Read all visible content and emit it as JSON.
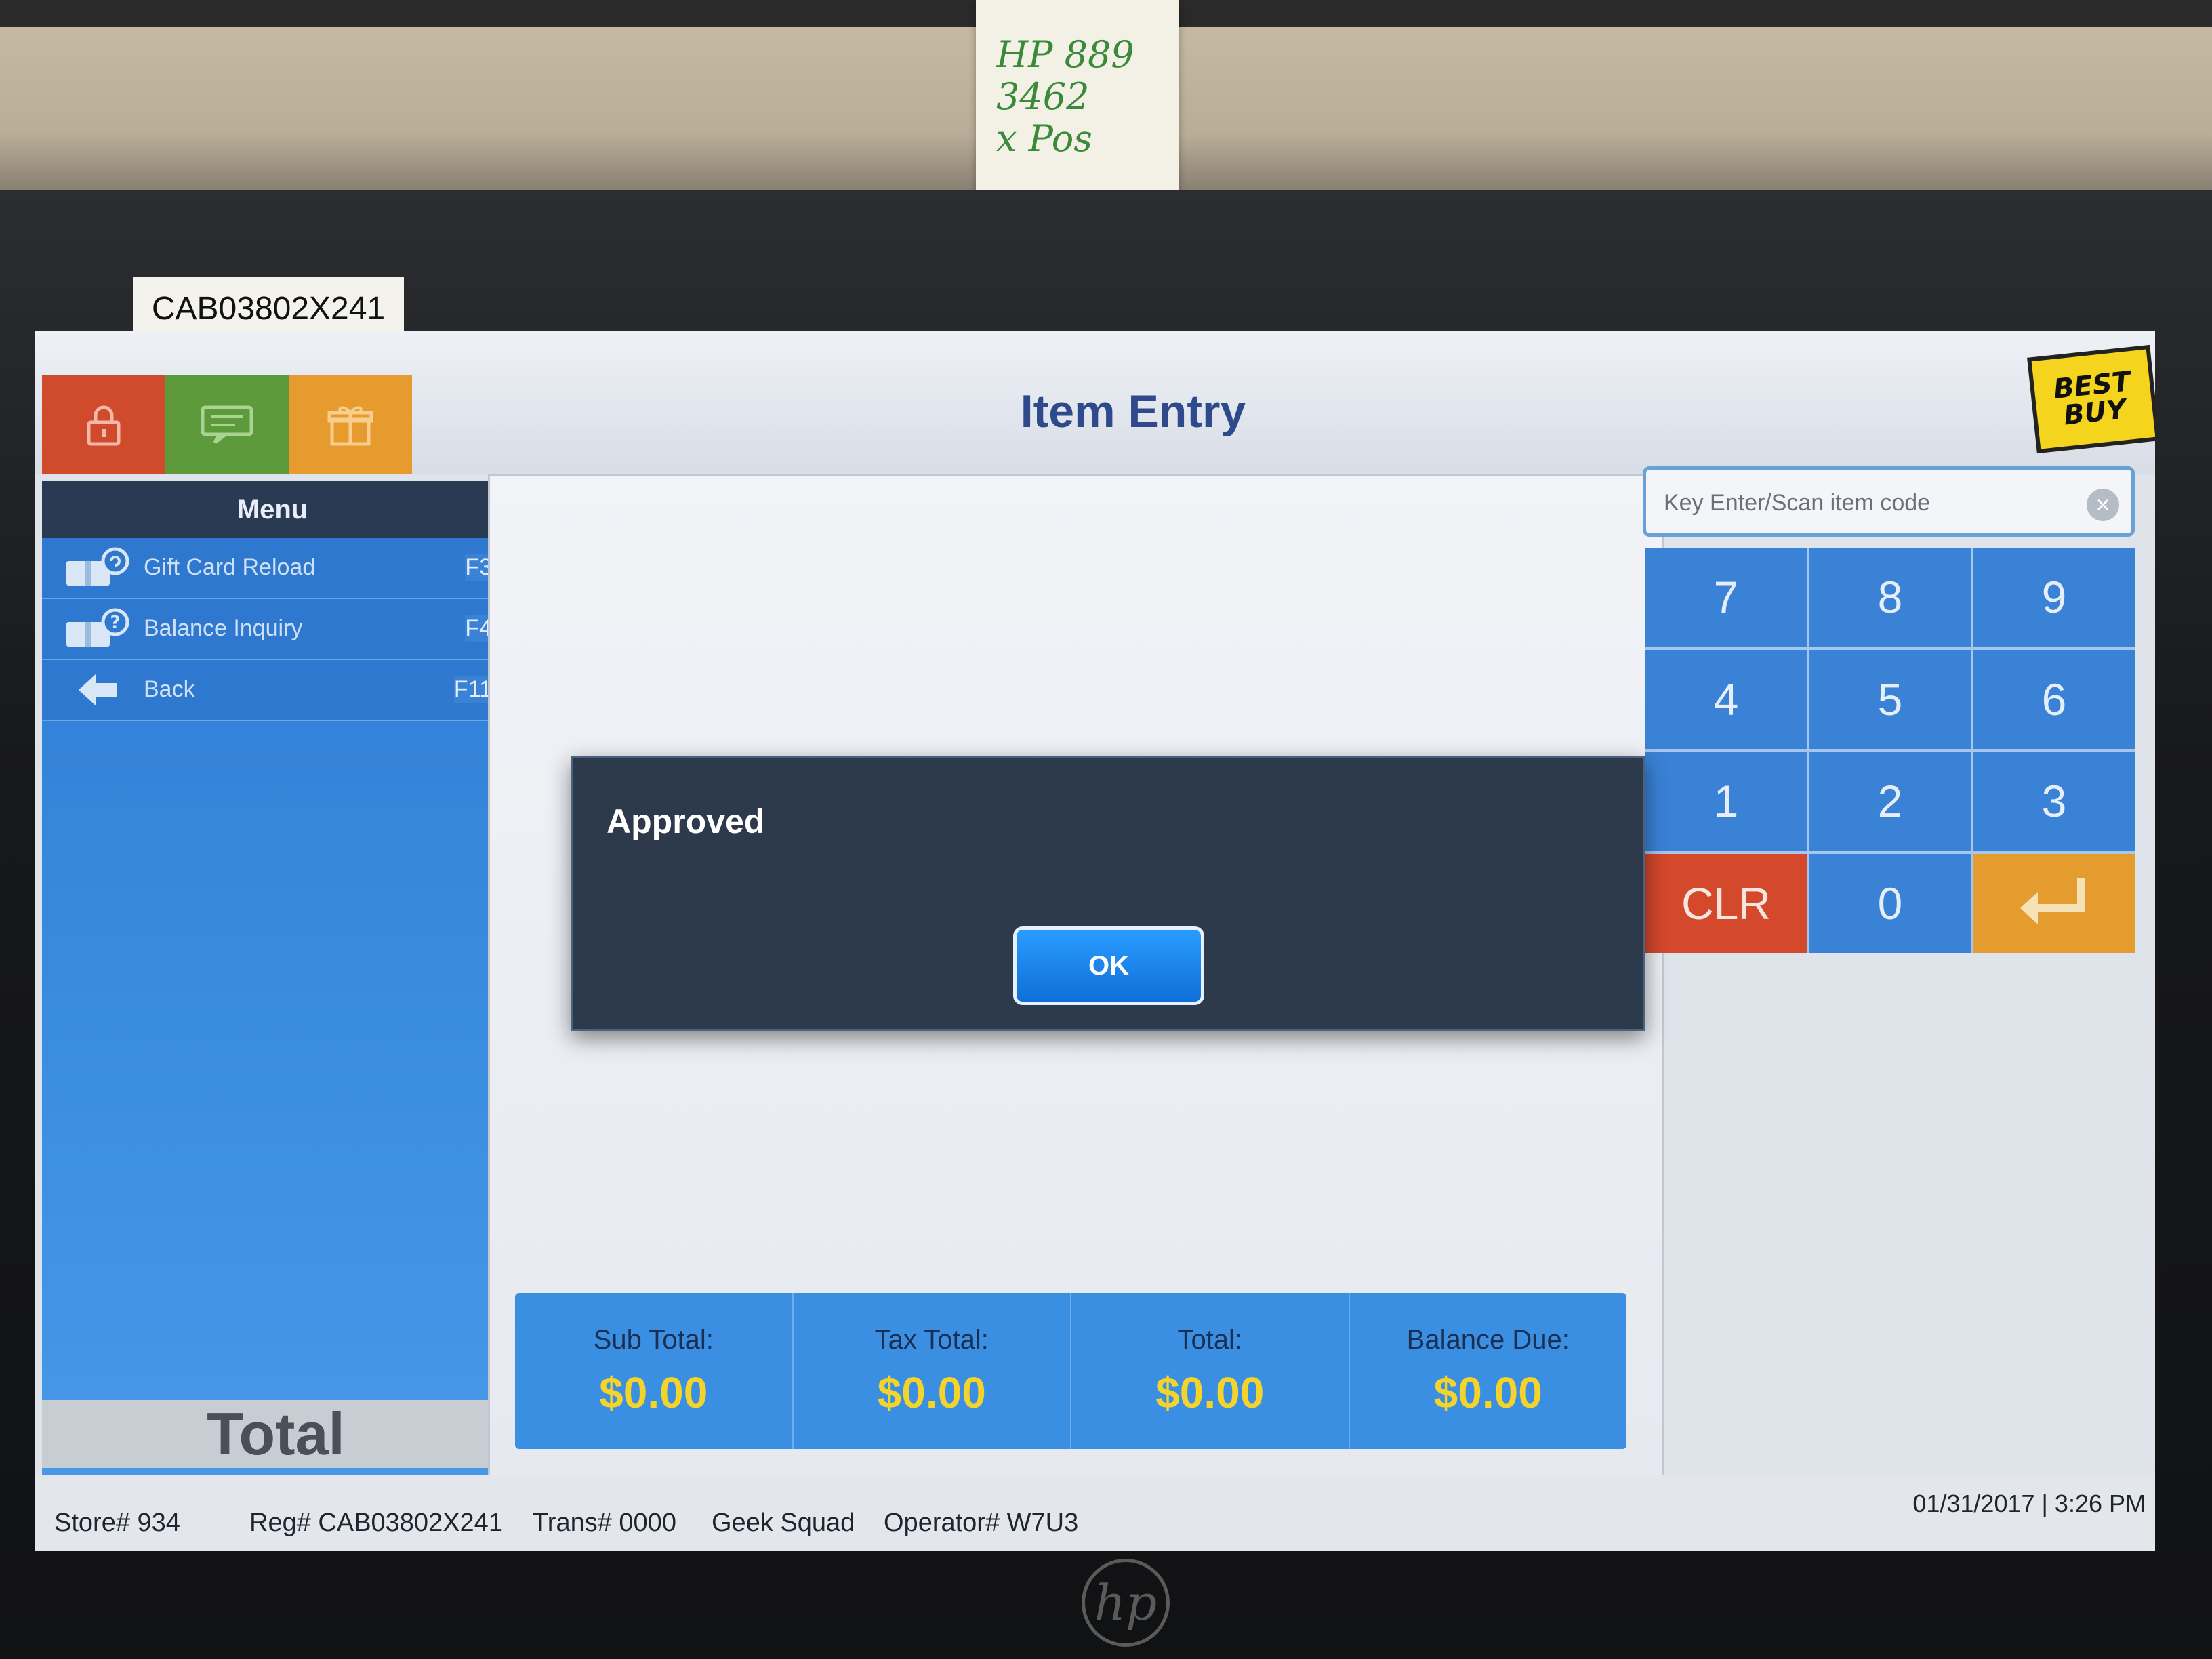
{
  "environment": {
    "sticky_note_text": "HP 889\n3462\nx Pos",
    "asset_tag": "CAB03802X241",
    "monitor_brand": "hp"
  },
  "header": {
    "title": "Item Entry",
    "logo_text": [
      "BEST",
      "BUY"
    ],
    "tiles": [
      {
        "icon": "lock-icon",
        "color": "#d04a2c"
      },
      {
        "icon": "message-icon",
        "color": "#5c9a3c"
      },
      {
        "icon": "gift-icon",
        "color": "#e79a2e"
      }
    ]
  },
  "sidebar": {
    "header": "Menu",
    "items": [
      {
        "label": "Gift Card Reload",
        "key": "F3",
        "icon": "gift-card-reload-icon"
      },
      {
        "label": "Balance Inquiry",
        "key": "F4",
        "icon": "balance-inquiry-icon"
      },
      {
        "label": "Back",
        "key": "F11",
        "icon": "back-arrow-icon"
      }
    ],
    "total_label": "Total"
  },
  "scan": {
    "placeholder": "Key Enter/Scan item code",
    "value": ""
  },
  "keypad": {
    "keys": [
      "7",
      "8",
      "9",
      "4",
      "5",
      "6",
      "1",
      "2",
      "3",
      "CLR",
      "0",
      "↵"
    ]
  },
  "dialog": {
    "message": "Approved",
    "ok_label": "OK"
  },
  "summary": [
    {
      "label": "Sub Total:",
      "value": "$0.00"
    },
    {
      "label": "Tax Total:",
      "value": "$0.00"
    },
    {
      "label": "Total:",
      "value": "$0.00"
    },
    {
      "label": "Balance Due:",
      "value": "$0.00"
    }
  ],
  "status": {
    "store": "Store# 934",
    "register": "Reg# CAB03802X241",
    "transaction": "Trans# 0000",
    "department": "Geek Squad",
    "operator": "Operator# W7U3",
    "date": "01/31/2017",
    "separator": "|",
    "time": "3:26 PM"
  },
  "colors": {
    "accent_blue": "#3a82d6",
    "clear_red": "#d4482c",
    "enter_orange": "#e59c2e",
    "amount_yellow": "#f4d32a",
    "dialog_bg": "#2c3a4c"
  }
}
